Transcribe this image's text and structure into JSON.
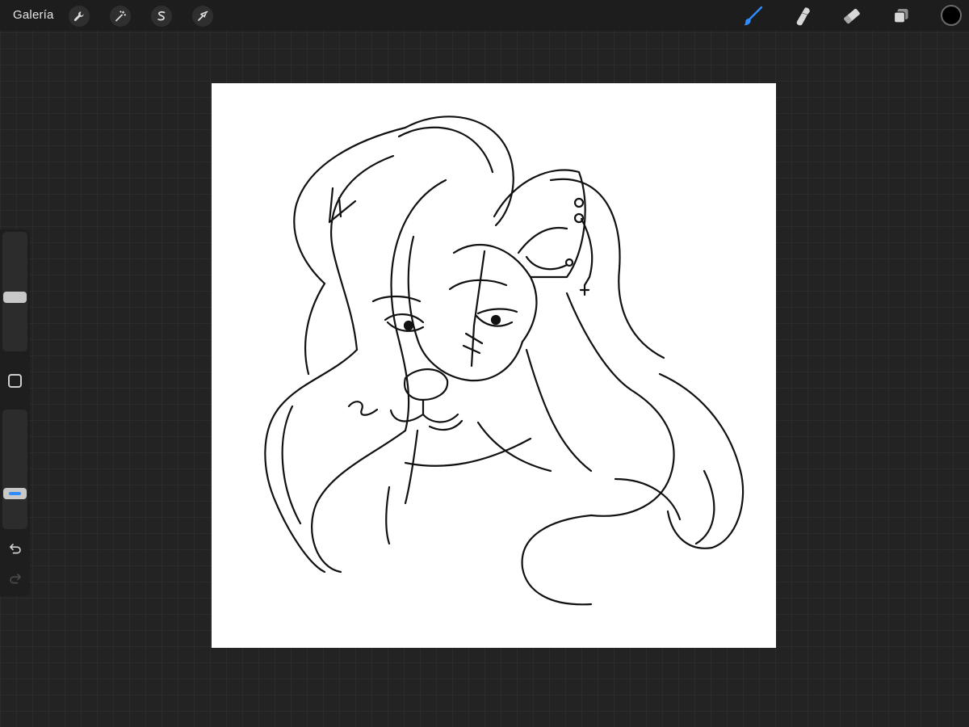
{
  "topbar": {
    "gallery_label": "Galería",
    "left_tools": [
      {
        "icon": "wrench-icon",
        "name": "actions"
      },
      {
        "icon": "magic-wand-icon",
        "name": "adjustments"
      },
      {
        "icon": "selection-s-icon",
        "name": "selection"
      },
      {
        "icon": "arrow-cursor-icon",
        "name": "transform"
      }
    ],
    "right_tools": [
      {
        "icon": "brush-icon",
        "name": "paint",
        "active": true
      },
      {
        "icon": "smudge-icon",
        "name": "smudge"
      },
      {
        "icon": "eraser-icon",
        "name": "eraser"
      },
      {
        "icon": "layers-icon",
        "name": "layers"
      }
    ],
    "current_color": "#000000"
  },
  "sidebar": {
    "brush_size_slider": {
      "level": 0.45
    },
    "opacity_slider": {
      "level": 0.27,
      "accent": "#2f8cff"
    },
    "undo_icon": "undo-icon",
    "redo_icon": "redo-icon"
  },
  "colors": {
    "background": "#232323",
    "active_tool": "#2f8cff",
    "canvas": "#ffffff"
  }
}
